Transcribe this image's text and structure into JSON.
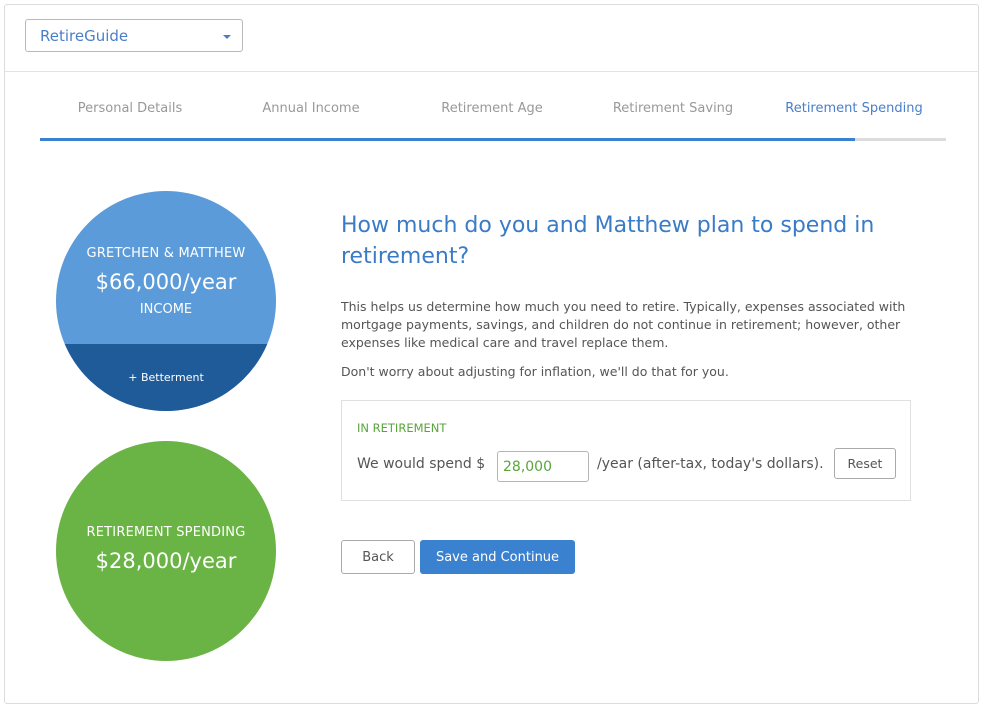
{
  "app_selector": {
    "label": "RetireGuide",
    "icon": "caret-down-icon"
  },
  "steps": [
    {
      "label": "Personal Details",
      "active": false
    },
    {
      "label": "Annual Income",
      "active": false
    },
    {
      "label": "Retirement Age",
      "active": false
    },
    {
      "label": "Retirement Saving",
      "active": false
    },
    {
      "label": "Retirement Spending",
      "active": true
    }
  ],
  "progress": {
    "fraction": 0.9
  },
  "income_circle": {
    "title": "GRETCHEN & MATTHEW",
    "amount": "$66,000/year",
    "subtitle": "INCOME",
    "footer": "+ Betterment",
    "color": "#5b9bd9",
    "footer_color": "#1f5a99"
  },
  "spending_circle": {
    "title": "RETIREMENT SPENDING",
    "amount": "$28,000/year",
    "color": "#6ab345"
  },
  "main": {
    "question": "How much do you and Matthew plan to spend in retirement?",
    "description": "This helps us determine how much you need to retire. Typically, expenses associated with mortgage payments, savings, and children do not continue in retirement; however, other expenses like medical care and travel replace them.",
    "note": "Don't worry about adjusting for inflation, we'll do that for you."
  },
  "panel": {
    "label": "IN RETIREMENT",
    "prefix": "We would spend $",
    "value": "28,000",
    "suffix": "/year (after-tax, today's dollars).",
    "reset_label": "Reset"
  },
  "actions": {
    "back_label": "Back",
    "save_label": "Save and Continue"
  },
  "colors": {
    "accent": "#3a81d0",
    "green": "#5aa53b"
  }
}
